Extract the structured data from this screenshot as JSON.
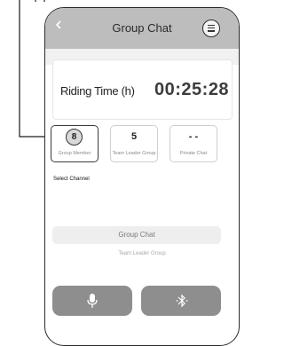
{
  "header": {
    "back_icon": "chevron-left-icon",
    "title": "Group Chat",
    "menu_icon": "hamburger-menu-icon"
  },
  "timer": {
    "label": "Riding Time (h)",
    "value": "00:25:28"
  },
  "stats": [
    {
      "value": "8",
      "label": "Group Member",
      "selected": true
    },
    {
      "value": "5",
      "label": "Team Leader Group",
      "selected": false
    },
    {
      "value": "- -",
      "label": "Private Chat",
      "selected": false
    }
  ],
  "select_channel_label": "Select Channel",
  "channels": {
    "current": "Group Chat",
    "next": "Team Leader Group"
  },
  "actions": {
    "mic_icon": "microphone-icon",
    "bluetooth_icon": "bluetooth-icon"
  },
  "colors": {
    "header_bg": "#bdbdbd",
    "button_bg": "#8e8e8e",
    "pointer_line": "#1a1a1a"
  }
}
